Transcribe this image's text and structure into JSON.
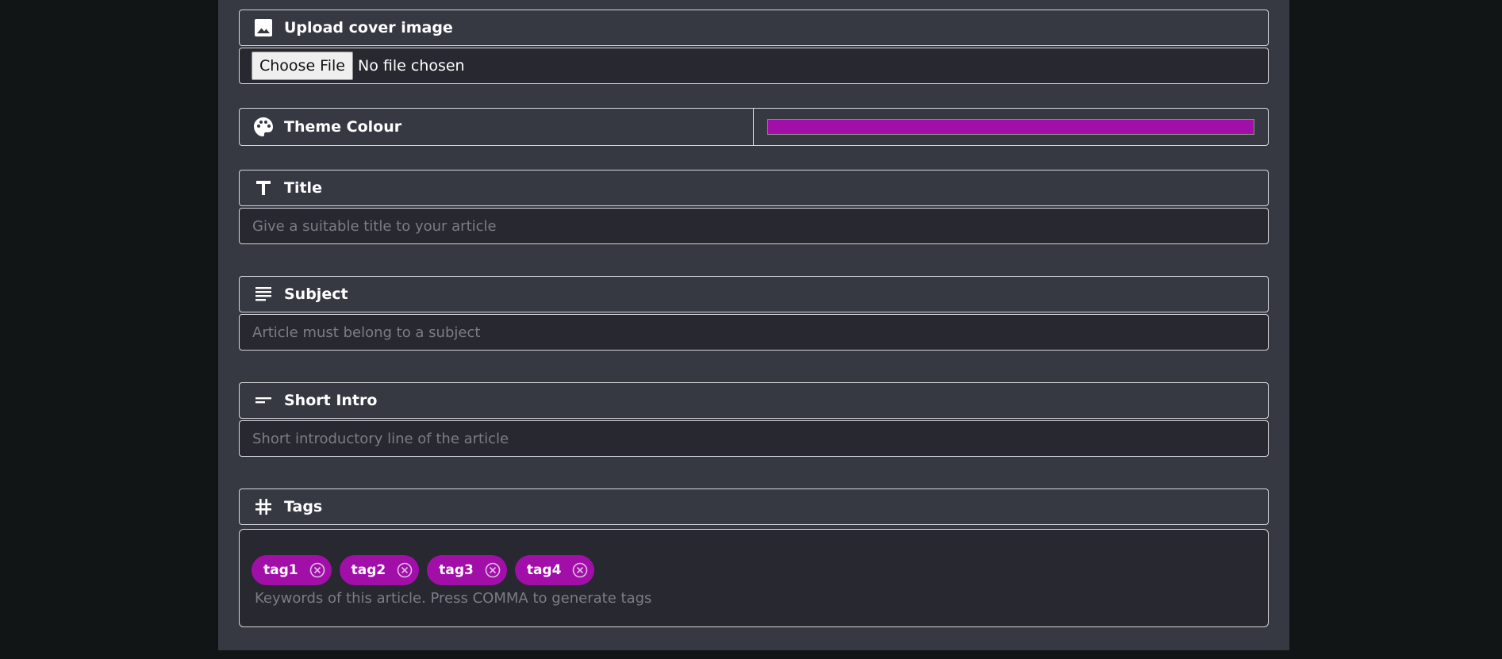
{
  "cover": {
    "label": "Upload cover image",
    "icon": "image-icon",
    "button_label": "Choose File",
    "status": "No file chosen"
  },
  "theme": {
    "label": "Theme Colour",
    "icon": "palette-icon",
    "value": "#a10fa8"
  },
  "title_field": {
    "label": "Title",
    "icon": "text-title-icon",
    "value": "",
    "placeholder": "Give a suitable title to your article"
  },
  "subject_field": {
    "label": "Subject",
    "icon": "paragraph-lines-icon",
    "value": "",
    "placeholder": "Article must belong to a subject"
  },
  "intro_field": {
    "label": "Short Intro",
    "icon": "short-text-icon",
    "value": "",
    "placeholder": "Short introductory line of the article"
  },
  "tags_field": {
    "label": "Tags",
    "icon": "hash-icon",
    "chip_color": "#a10fa8",
    "chips": [
      {
        "label": "tag1"
      },
      {
        "label": "tag2"
      },
      {
        "label": "tag3"
      },
      {
        "label": "tag4"
      }
    ],
    "placeholder": "Keywords of this article. Press COMMA to generate tags"
  }
}
